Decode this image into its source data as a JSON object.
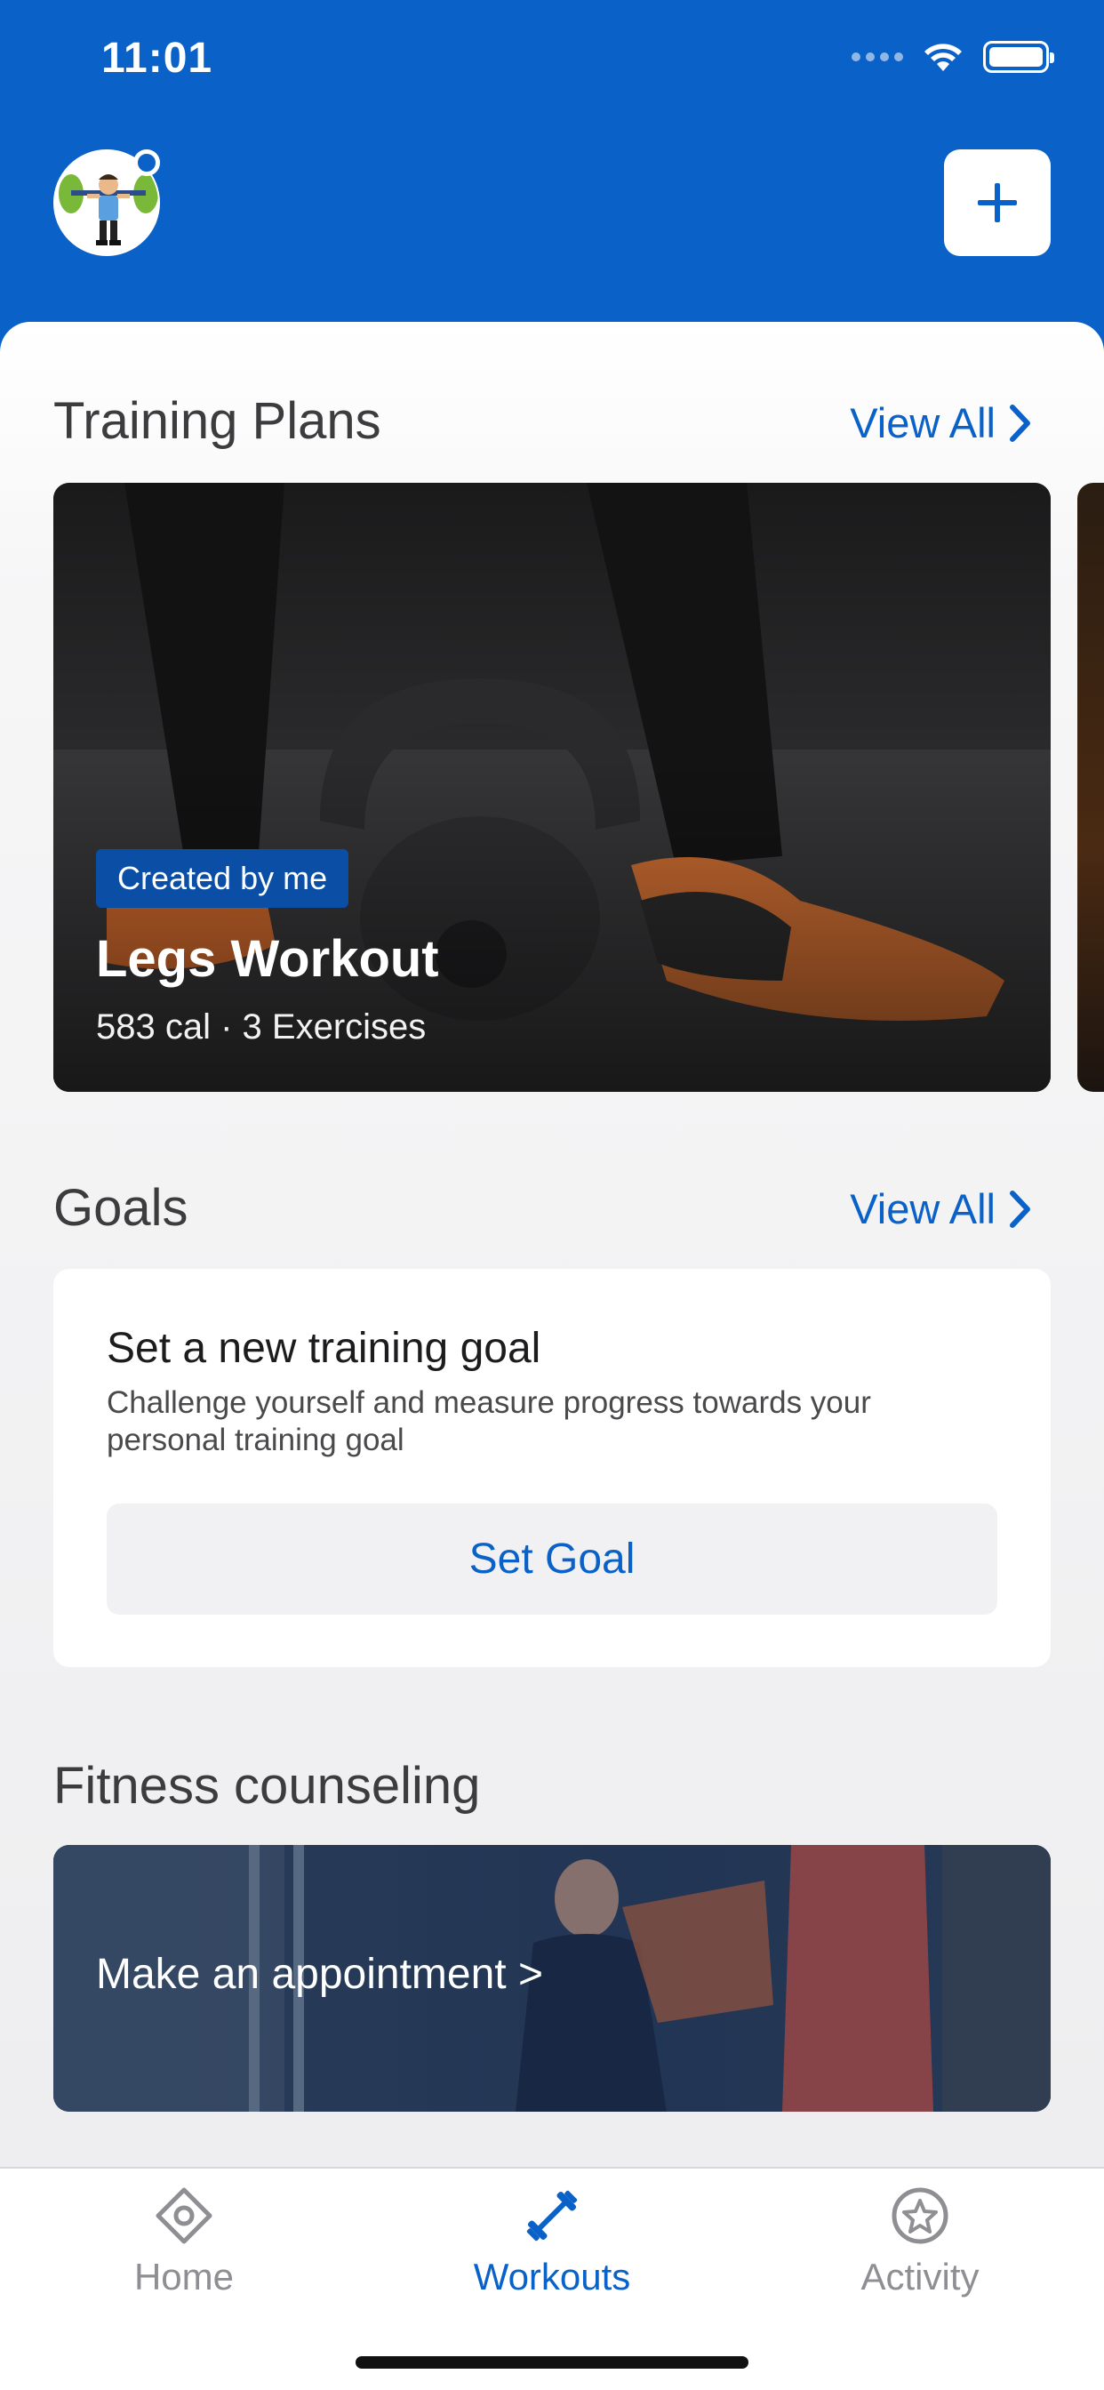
{
  "status_bar": {
    "time": "11:01"
  },
  "header": {
    "avatar_icon": "weightlifter-avatar-icon",
    "add_icon": "plus-icon"
  },
  "training_plans": {
    "title": "Training Plans",
    "view_all": "View All",
    "cards": [
      {
        "badge": "Created by me",
        "title": "Legs Workout",
        "meta": "583 cal · 3 Exercises"
      }
    ]
  },
  "goals": {
    "title": "Goals",
    "view_all": "View All",
    "card": {
      "title": "Set a new training goal",
      "description": "Challenge yourself and measure progress towards your personal training goal",
      "button": "Set Goal"
    }
  },
  "counseling": {
    "title": "Fitness counseling",
    "link": "Make an appointment >"
  },
  "tabs": [
    {
      "label": "Home",
      "icon": "home-target-icon",
      "active": false
    },
    {
      "label": "Workouts",
      "icon": "dumbbell-icon",
      "active": true
    },
    {
      "label": "Activity",
      "icon": "star-badge-icon",
      "active": false
    }
  ],
  "colors": {
    "brand": "#0a62c9",
    "inactive": "#8e8e93",
    "badge": "#0a4fa5"
  }
}
